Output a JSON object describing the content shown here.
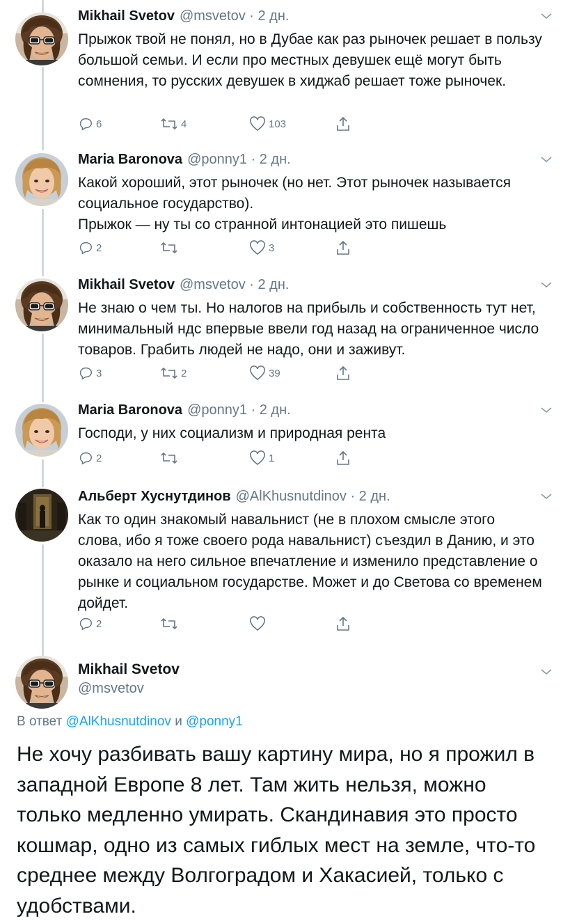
{
  "tweets": [
    {
      "name": "Mikhail Svetov",
      "handle": "@msvetov · 2 дн.",
      "text": "Прыжок твой не понял, но в Дубае как раз рыночек решает в пользу большой семьи. И если про местных девушек ещё могут быть сомнения, то русских девушек в хиджаб решает тоже рыночек.",
      "replies": "6",
      "retweets": "4",
      "likes": "103"
    },
    {
      "name": "Maria Baronova",
      "handle": "@ponny1 · 2 дн.",
      "text": "Какой хороший, этот рыночек (но нет. Этот рыночек называется социальное государство).",
      "text2": "Прыжок — ну ты со странной интонацией это пишешь",
      "replies": "2",
      "retweets": "",
      "likes": "3"
    },
    {
      "name": "Mikhail Svetov",
      "handle": "@msvetov · 2 дн.",
      "text": "Не знаю о чем ты. Но налогов на прибыль и собственность тут нет, минимальный ндс впервые ввели год назад на ограниченное число товаров. Грабить людей не надо, они и заживут.",
      "replies": "3",
      "retweets": "2",
      "likes": "39"
    },
    {
      "name": "Maria Baronova",
      "handle": "@ponny1 · 2 дн.",
      "text": "Господи, у них социализм и природная рента",
      "replies": "2",
      "retweets": "",
      "likes": "1"
    },
    {
      "name": "Альберт Хуснутдинов",
      "handle": "@AlKhusnutdinov · 2 дн.",
      "text": "Как то один знакомый навальнист (не в плохом смысле этого слова, ибо я тоже своего рода навальнист) съездил в Данию, и это оказало на него сильное впечатление и изменило представление о рынке и социальном государстве. Может и до Светова со временем дойдет.",
      "replies": "2",
      "retweets": "",
      "likes": ""
    }
  ],
  "main_tweet": {
    "name": "Mikhail Svetov",
    "handle": "@msvetov",
    "reply_prefix": "В ответ",
    "reply_user1": "@AlKhusnutdinov",
    "reply_and": "и",
    "reply_user2": "@ponny1",
    "text": "Не хочу разбивать вашу картину мира, но я прожил в западной Европе 8 лет. Там жить нельзя, можно только медленно умирать. Скандинавия это просто кошмар, одно из самых гиблых мест на земле, что-то среднее между Волгоградом и Хакасией, только с удобствами."
  },
  "colors": {
    "text": "#14171a",
    "secondary": "#657786",
    "link": "#1da1f2",
    "thread_line": "#cfd9de"
  },
  "icons": [
    "reply-icon",
    "retweet-icon",
    "like-icon",
    "share-icon",
    "chevron-down-icon"
  ]
}
